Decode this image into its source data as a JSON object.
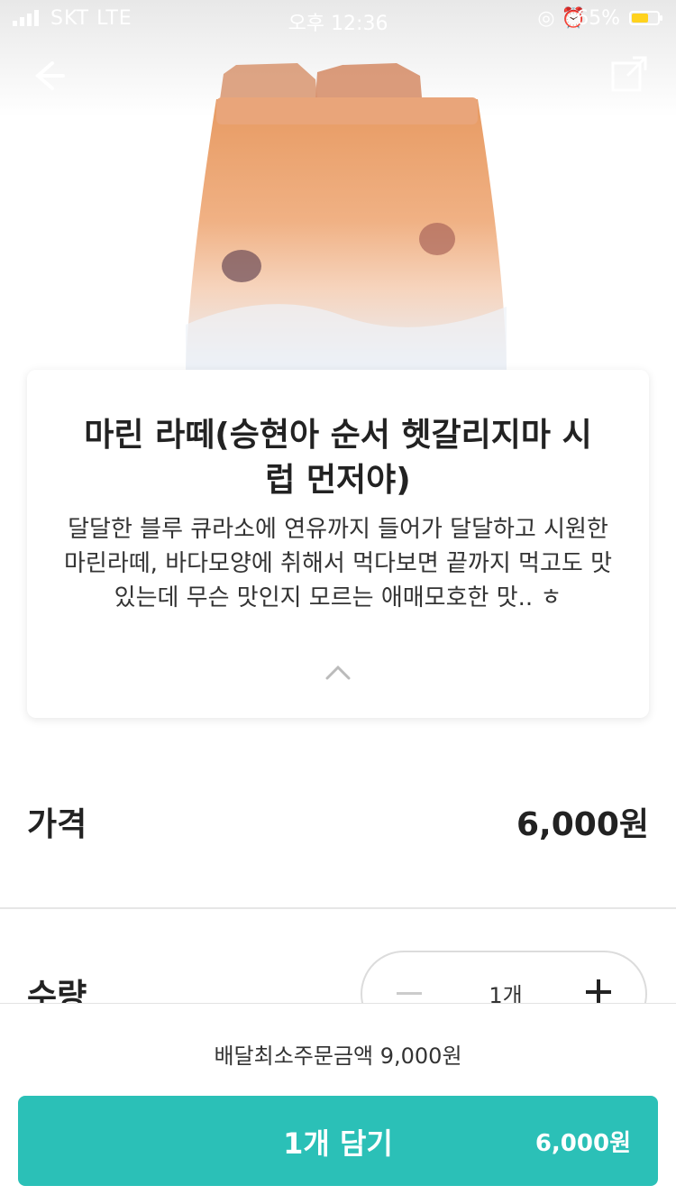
{
  "status_bar": {
    "carrier": "SKT LTE",
    "time": "오후 12:36",
    "battery_percent": "65%",
    "battery_level": 0.65
  },
  "header": {
    "back_icon": "back-arrow-icon",
    "share_icon": "share-icon"
  },
  "product": {
    "title": "마린 라떼(승현아 순서 헷갈리지마 시럽 먼저야)",
    "description": "달달한 블루 큐라소에 연유까지 들어가 달달하고 시원한 마린라떼, 바다모양에 취해서 먹다보면 끝까지 먹고도 맛있는데 무슨 맛인지 모르는 애매모호한 맛.. ㅎ"
  },
  "price": {
    "label": "가격",
    "value": "6,000원"
  },
  "quantity": {
    "label": "수량",
    "value": "1개"
  },
  "bottom": {
    "min_order": "배달최소주문금액 9,000원",
    "cart_button_label": "1개 담기",
    "cart_button_price": "6,000원",
    "accent_color": "#2bc0b7"
  }
}
